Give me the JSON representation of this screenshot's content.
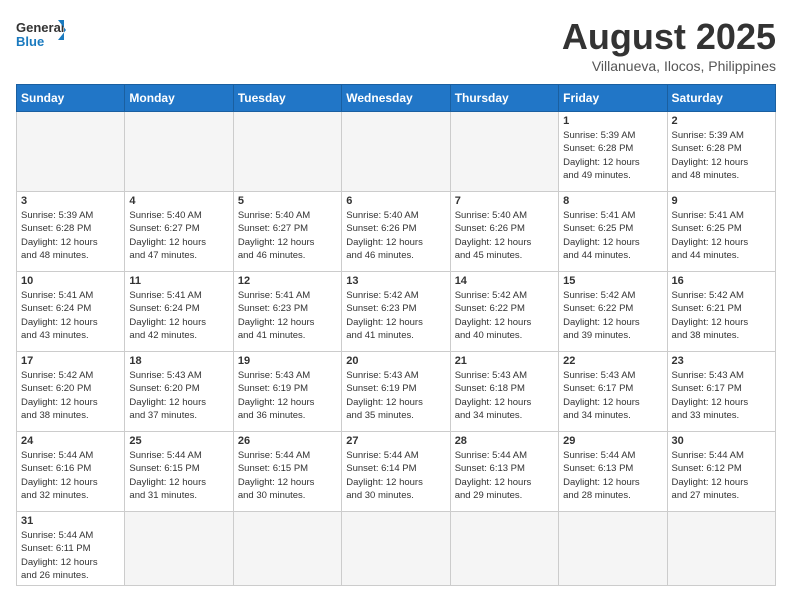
{
  "header": {
    "logo_general": "General",
    "logo_blue": "Blue",
    "month_title": "August 2025",
    "subtitle": "Villanueva, Ilocos, Philippines"
  },
  "weekdays": [
    "Sunday",
    "Monday",
    "Tuesday",
    "Wednesday",
    "Thursday",
    "Friday",
    "Saturday"
  ],
  "weeks": [
    [
      {
        "day": "",
        "info": ""
      },
      {
        "day": "",
        "info": ""
      },
      {
        "day": "",
        "info": ""
      },
      {
        "day": "",
        "info": ""
      },
      {
        "day": "",
        "info": ""
      },
      {
        "day": "1",
        "info": "Sunrise: 5:39 AM\nSunset: 6:28 PM\nDaylight: 12 hours\nand 49 minutes."
      },
      {
        "day": "2",
        "info": "Sunrise: 5:39 AM\nSunset: 6:28 PM\nDaylight: 12 hours\nand 48 minutes."
      }
    ],
    [
      {
        "day": "3",
        "info": "Sunrise: 5:39 AM\nSunset: 6:28 PM\nDaylight: 12 hours\nand 48 minutes."
      },
      {
        "day": "4",
        "info": "Sunrise: 5:40 AM\nSunset: 6:27 PM\nDaylight: 12 hours\nand 47 minutes."
      },
      {
        "day": "5",
        "info": "Sunrise: 5:40 AM\nSunset: 6:27 PM\nDaylight: 12 hours\nand 46 minutes."
      },
      {
        "day": "6",
        "info": "Sunrise: 5:40 AM\nSunset: 6:26 PM\nDaylight: 12 hours\nand 46 minutes."
      },
      {
        "day": "7",
        "info": "Sunrise: 5:40 AM\nSunset: 6:26 PM\nDaylight: 12 hours\nand 45 minutes."
      },
      {
        "day": "8",
        "info": "Sunrise: 5:41 AM\nSunset: 6:25 PM\nDaylight: 12 hours\nand 44 minutes."
      },
      {
        "day": "9",
        "info": "Sunrise: 5:41 AM\nSunset: 6:25 PM\nDaylight: 12 hours\nand 44 minutes."
      }
    ],
    [
      {
        "day": "10",
        "info": "Sunrise: 5:41 AM\nSunset: 6:24 PM\nDaylight: 12 hours\nand 43 minutes."
      },
      {
        "day": "11",
        "info": "Sunrise: 5:41 AM\nSunset: 6:24 PM\nDaylight: 12 hours\nand 42 minutes."
      },
      {
        "day": "12",
        "info": "Sunrise: 5:41 AM\nSunset: 6:23 PM\nDaylight: 12 hours\nand 41 minutes."
      },
      {
        "day": "13",
        "info": "Sunrise: 5:42 AM\nSunset: 6:23 PM\nDaylight: 12 hours\nand 41 minutes."
      },
      {
        "day": "14",
        "info": "Sunrise: 5:42 AM\nSunset: 6:22 PM\nDaylight: 12 hours\nand 40 minutes."
      },
      {
        "day": "15",
        "info": "Sunrise: 5:42 AM\nSunset: 6:22 PM\nDaylight: 12 hours\nand 39 minutes."
      },
      {
        "day": "16",
        "info": "Sunrise: 5:42 AM\nSunset: 6:21 PM\nDaylight: 12 hours\nand 38 minutes."
      }
    ],
    [
      {
        "day": "17",
        "info": "Sunrise: 5:42 AM\nSunset: 6:20 PM\nDaylight: 12 hours\nand 38 minutes."
      },
      {
        "day": "18",
        "info": "Sunrise: 5:43 AM\nSunset: 6:20 PM\nDaylight: 12 hours\nand 37 minutes."
      },
      {
        "day": "19",
        "info": "Sunrise: 5:43 AM\nSunset: 6:19 PM\nDaylight: 12 hours\nand 36 minutes."
      },
      {
        "day": "20",
        "info": "Sunrise: 5:43 AM\nSunset: 6:19 PM\nDaylight: 12 hours\nand 35 minutes."
      },
      {
        "day": "21",
        "info": "Sunrise: 5:43 AM\nSunset: 6:18 PM\nDaylight: 12 hours\nand 34 minutes."
      },
      {
        "day": "22",
        "info": "Sunrise: 5:43 AM\nSunset: 6:17 PM\nDaylight: 12 hours\nand 34 minutes."
      },
      {
        "day": "23",
        "info": "Sunrise: 5:43 AM\nSunset: 6:17 PM\nDaylight: 12 hours\nand 33 minutes."
      }
    ],
    [
      {
        "day": "24",
        "info": "Sunrise: 5:44 AM\nSunset: 6:16 PM\nDaylight: 12 hours\nand 32 minutes."
      },
      {
        "day": "25",
        "info": "Sunrise: 5:44 AM\nSunset: 6:15 PM\nDaylight: 12 hours\nand 31 minutes."
      },
      {
        "day": "26",
        "info": "Sunrise: 5:44 AM\nSunset: 6:15 PM\nDaylight: 12 hours\nand 30 minutes."
      },
      {
        "day": "27",
        "info": "Sunrise: 5:44 AM\nSunset: 6:14 PM\nDaylight: 12 hours\nand 30 minutes."
      },
      {
        "day": "28",
        "info": "Sunrise: 5:44 AM\nSunset: 6:13 PM\nDaylight: 12 hours\nand 29 minutes."
      },
      {
        "day": "29",
        "info": "Sunrise: 5:44 AM\nSunset: 6:13 PM\nDaylight: 12 hours\nand 28 minutes."
      },
      {
        "day": "30",
        "info": "Sunrise: 5:44 AM\nSunset: 6:12 PM\nDaylight: 12 hours\nand 27 minutes."
      }
    ],
    [
      {
        "day": "31",
        "info": "Sunrise: 5:44 AM\nSunset: 6:11 PM\nDaylight: 12 hours\nand 26 minutes.",
        "last": true
      },
      {
        "day": "",
        "info": "",
        "last": true
      },
      {
        "day": "",
        "info": "",
        "last": true
      },
      {
        "day": "",
        "info": "",
        "last": true
      },
      {
        "day": "",
        "info": "",
        "last": true
      },
      {
        "day": "",
        "info": "",
        "last": true
      },
      {
        "day": "",
        "info": "",
        "last": true
      }
    ]
  ]
}
